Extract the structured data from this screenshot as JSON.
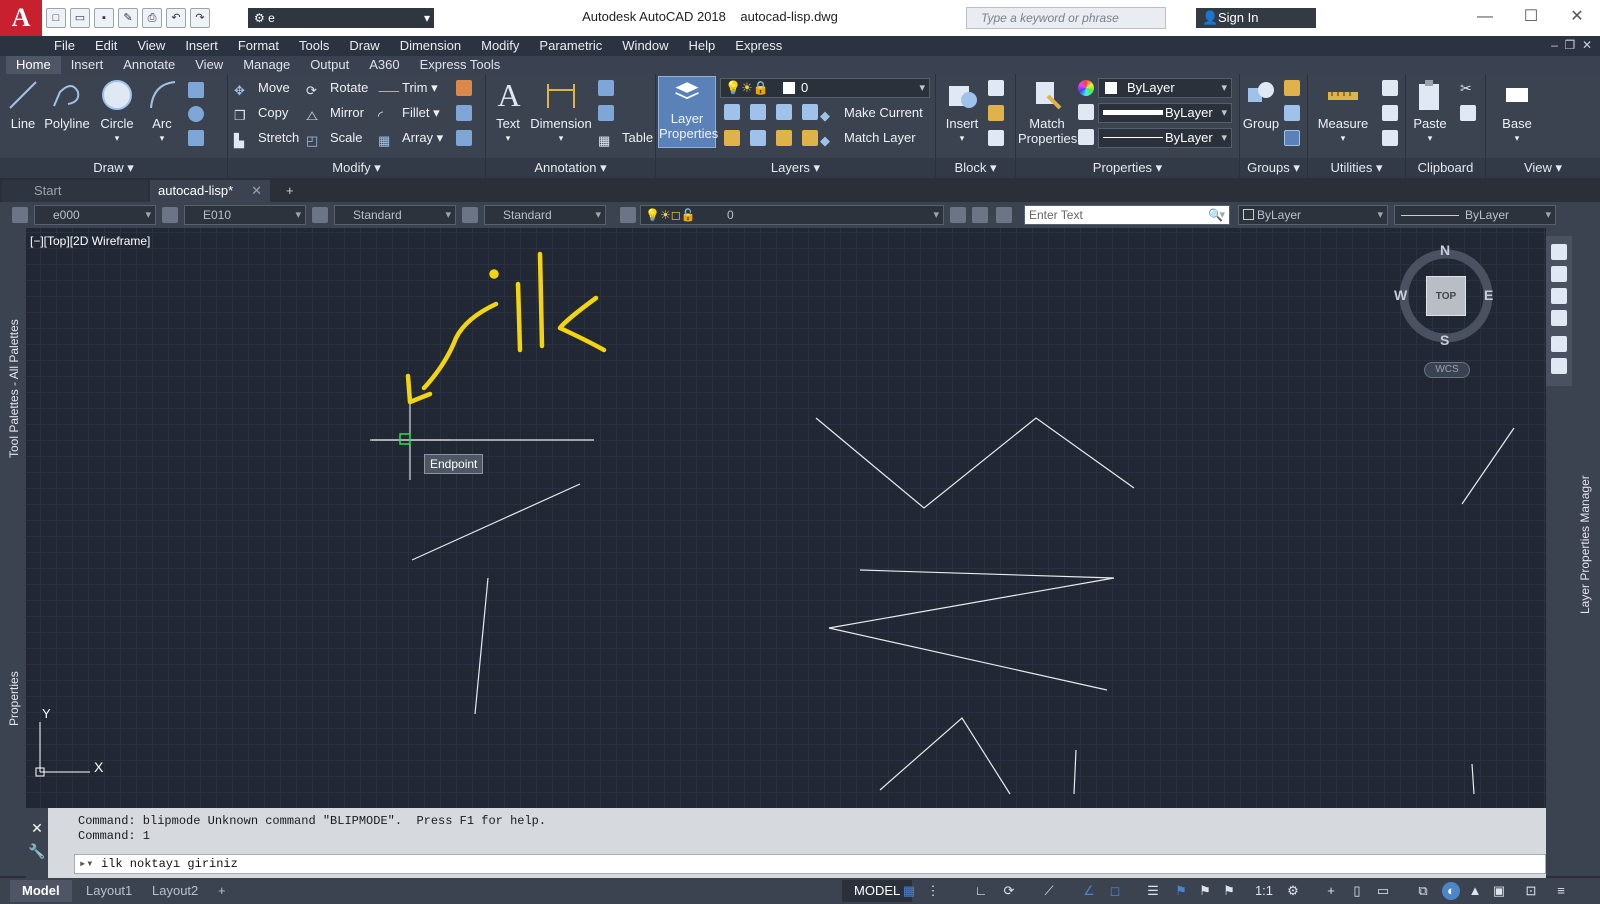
{
  "app": {
    "logo_letter": "A",
    "title": "Autodesk AutoCAD 2018",
    "filename": "autocad-lisp.dwg",
    "workspace": "e",
    "search_placeholder": "Type a keyword or phrase",
    "signin": "Sign In"
  },
  "menu": [
    "File",
    "Edit",
    "View",
    "Insert",
    "Format",
    "Tools",
    "Draw",
    "Dimension",
    "Modify",
    "Parametric",
    "Window",
    "Help",
    "Express"
  ],
  "ribbon_tabs": [
    "Home",
    "Insert",
    "Annotate",
    "View",
    "Manage",
    "Output",
    "A360",
    "Express Tools"
  ],
  "ribbon": {
    "draw": {
      "title": "Draw",
      "line": "Line",
      "polyline": "Polyline",
      "circle": "Circle",
      "arc": "Arc"
    },
    "modify": {
      "title": "Modify",
      "move": "Move",
      "rotate": "Rotate",
      "trim": "Trim",
      "copy": "Copy",
      "mirror": "Mirror",
      "fillet": "Fillet",
      "stretch": "Stretch",
      "scale": "Scale",
      "array": "Array"
    },
    "annotation": {
      "title": "Annotation",
      "text": "Text",
      "dimension": "Dimension",
      "table": "Table"
    },
    "layers": {
      "title": "Layers",
      "layer_properties_1": "Layer",
      "layer_properties_2": "Properties",
      "current_layer": "0",
      "make_current": "Make Current",
      "match_layer": "Match Layer"
    },
    "block": {
      "title": "Block",
      "insert": "Insert"
    },
    "properties": {
      "title": "Properties",
      "match_1": "Match",
      "match_2": "Properties",
      "color": "ByLayer",
      "lineweight": "ByLayer",
      "linetype": "ByLayer"
    },
    "groups": {
      "title": "Groups",
      "group": "Group"
    },
    "utilities": {
      "title": "Utilities",
      "measure": "Measure"
    },
    "clipboard": {
      "title": "Clipboard",
      "paste": "Paste"
    },
    "view": {
      "title": "View",
      "base": "Base"
    }
  },
  "doc_tabs": {
    "start": "Start",
    "active": "autocad-lisp*",
    "add": "+"
  },
  "propbar": {
    "text_style": "e000",
    "dim_style": "E010",
    "table_style": "Standard",
    "mleader_style": "Standard",
    "layer": "0",
    "enter_text": "Enter Text",
    "color": "ByLayer",
    "linetype": "ByLayer"
  },
  "left_palettes": {
    "tool_palettes": "Tool Palettes - All Palettes",
    "properties": "Properties"
  },
  "right_palette": "Layer Properties Manager",
  "viewport": {
    "label": "[−][Top][2D Wireframe]",
    "snap_tooltip": "Endpoint",
    "annotation": "ilk"
  },
  "viewcube": {
    "n": "N",
    "s": "S",
    "e": "E",
    "w": "W",
    "face": "TOP",
    "wcs": "WCS"
  },
  "ucs": {
    "x": "X",
    "y": "Y"
  },
  "command": {
    "history_1": "Command: blipmode Unknown command \"BLIPMODE\".  Press F1 for help.",
    "history_2": "Command: 1",
    "prompt": "ilk noktayı giriniz"
  },
  "layout_tabs": [
    "Model",
    "Layout1",
    "Layout2"
  ],
  "status": {
    "model": "MODEL",
    "scale": "1:1"
  },
  "colors": {
    "canvas": "#212733",
    "ui_dark": "#3b4250",
    "accent_blue": "#4a86c8",
    "annotation_yellow": "#f2d40f",
    "logo_red": "#c8202f"
  }
}
